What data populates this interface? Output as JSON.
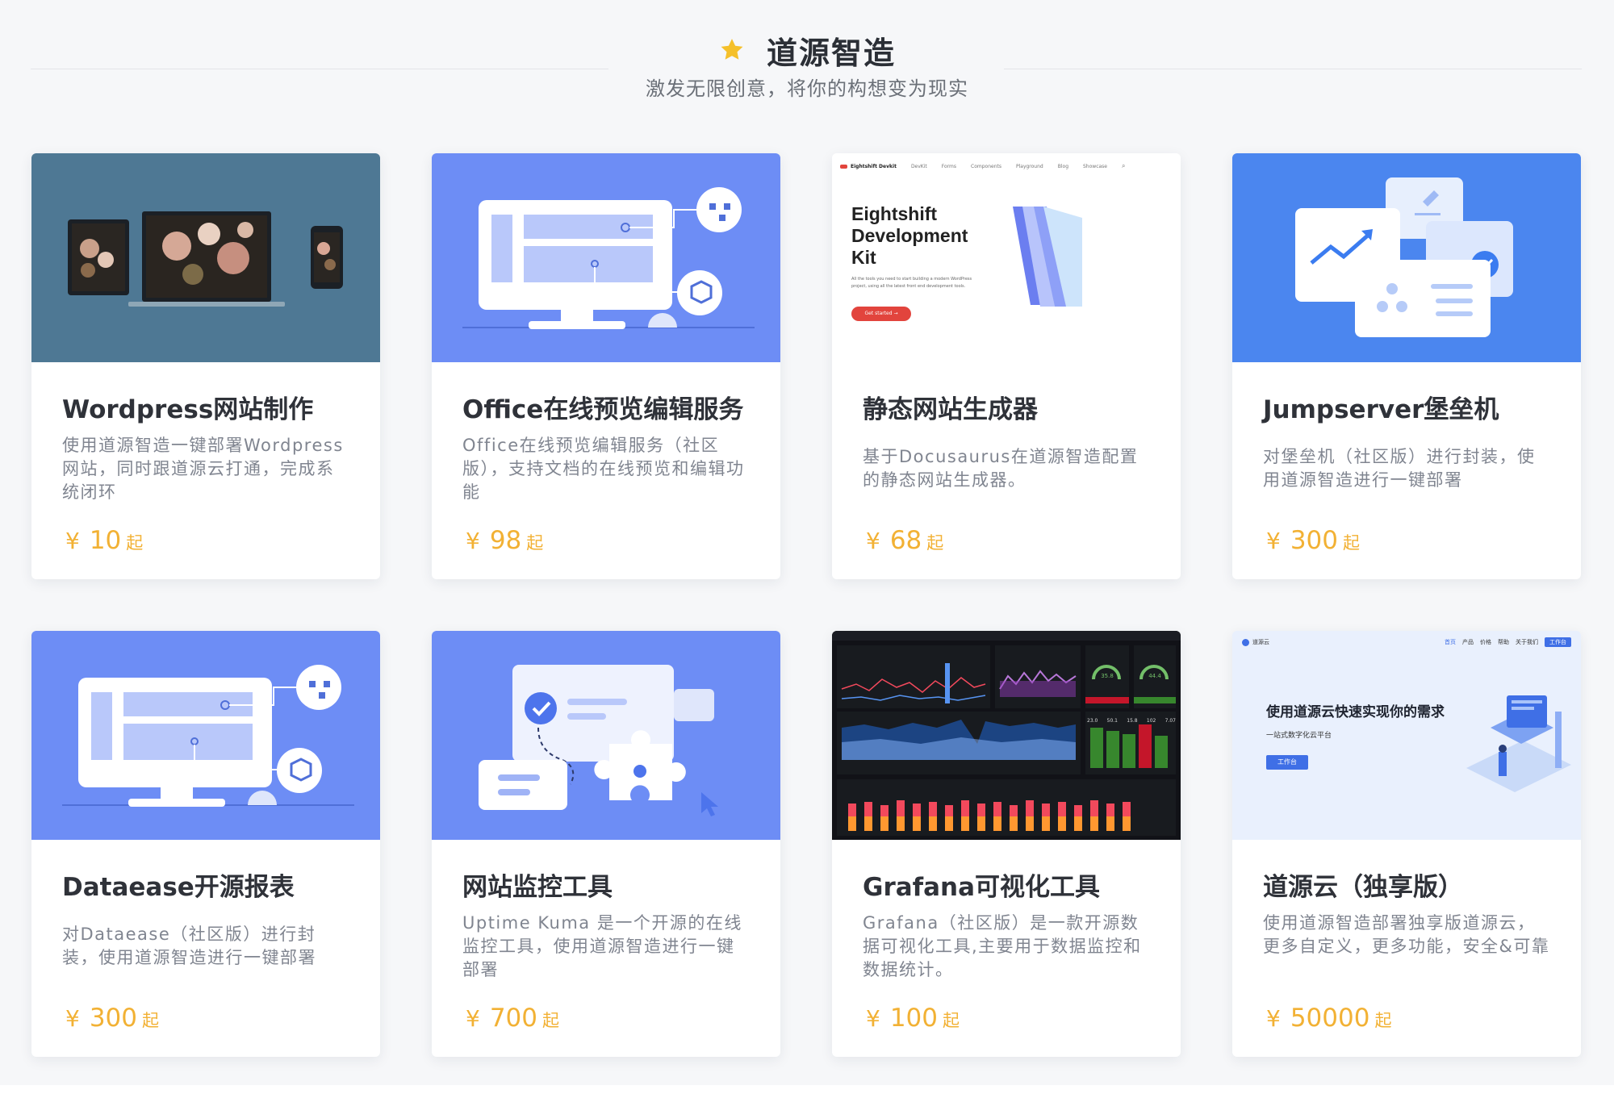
{
  "header": {
    "title": "道源智造",
    "subtitle": "激发无限创意，将你的构想变为现实",
    "star_color": "#f5c02a"
  },
  "price_color": "#f2b134",
  "cards": [
    {
      "title": "Wordpress网站制作",
      "desc": "使用道源智造一键部署Wordpress网站，同时跟道源云打通，完成系统闭环",
      "price_prefix": "¥",
      "price": "10",
      "price_suffix": "起",
      "thumb": "wordpress-mockup"
    },
    {
      "title": "Office在线预览编辑服务",
      "desc": "Office在线预览编辑服务（社区版），支持文档的在线预览和编辑功能",
      "price_prefix": "¥",
      "price": "98",
      "price_suffix": "起",
      "thumb": "monitor-illustration"
    },
    {
      "title": "静态网站生成器",
      "desc": "基于Docusaurus在道源智造配置的静态网站生成器。",
      "price_prefix": "¥",
      "price": "68",
      "price_suffix": "起",
      "thumb": "eightshift-screenshot",
      "screenshot": {
        "brand": "Eightshift Devkit",
        "nav": [
          "DevKit",
          "Forms",
          "Components",
          "Playground",
          "Blog",
          "Showcase"
        ],
        "heading_line1": "Eightshift",
        "heading_line2": "Development",
        "heading_line3": "Kit",
        "body": "All the tools you need to start building a modern WordPress project, using all the latest front end development tools.",
        "cta": "Get started →"
      }
    },
    {
      "title": "Jumpserver堡垒机",
      "desc": "对堡垒机（社区版）进行封装，使用道源智造进行一键部署",
      "price_prefix": "¥",
      "price": "300",
      "price_suffix": "起",
      "thumb": "bastion-illustration"
    },
    {
      "title": "Dataease开源报表",
      "desc": "对Dataease（社区版）进行封装，使用道源智造进行一键部署",
      "price_prefix": "¥",
      "price": "300",
      "price_suffix": "起",
      "thumb": "monitor-illustration"
    },
    {
      "title": "网站监控工具",
      "desc": "Uptime Kuma 是一个开源的在线监控工具，使用道源智造进行一键部署",
      "price_prefix": "¥",
      "price": "700",
      "price_suffix": "起",
      "thumb": "puzzle-illustration"
    },
    {
      "title": "Grafana可视化工具",
      "desc": "Grafana（社区版）是一款开源数据可视化工具,主要用于数据监控和数据统计。",
      "price_prefix": "¥",
      "price": "100",
      "price_suffix": "起",
      "thumb": "grafana-dashboard",
      "dashboard": {
        "gauge_1": "35.8",
        "gauge_2": "44.4",
        "stats": [
          "23.0",
          "50.1",
          "15.8",
          "102",
          "7.07"
        ]
      }
    },
    {
      "title": "道源云（独享版）",
      "desc": "使用道源智造部署独享版道源云，更多自定义，更多功能，安全&可靠",
      "price_prefix": "¥",
      "price": "50000",
      "price_suffix": "起",
      "thumb": "daoyuan-cloud",
      "screenshot": {
        "logo": "道源云",
        "nav": [
          "首页",
          "产品",
          "价格",
          "帮助",
          "关于我们"
        ],
        "nav_button": "工作台",
        "headline": "使用道源云快速实现你的需求",
        "subline": "一站式数字化云平台",
        "cta": "工作台"
      }
    }
  ]
}
